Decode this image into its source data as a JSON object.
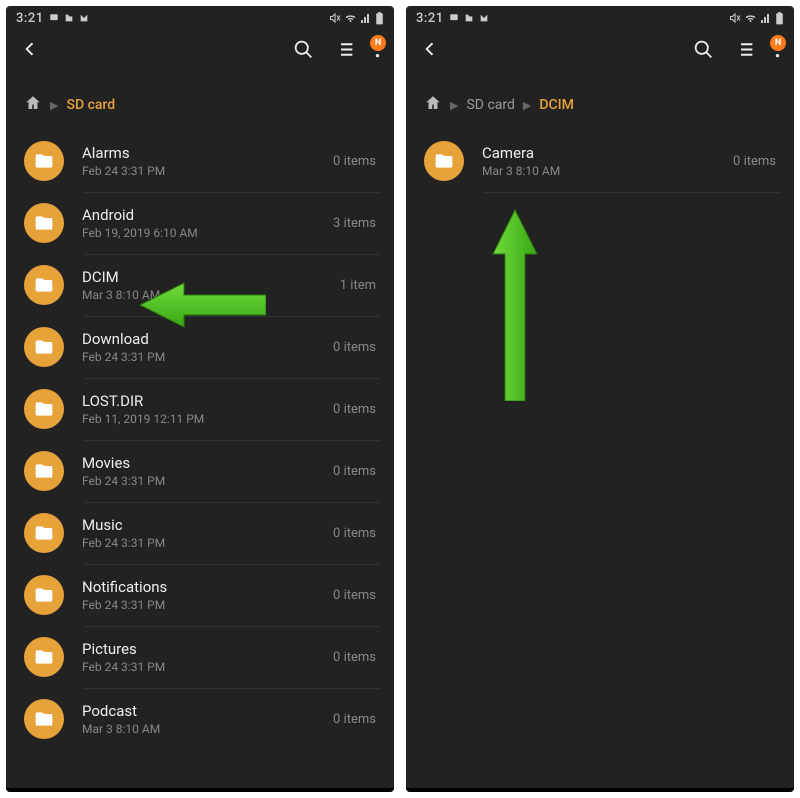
{
  "status": {
    "time": "3:21"
  },
  "notif_badge": "N",
  "screens": [
    {
      "breadcrumb": [
        {
          "label": "SD card",
          "last": true
        }
      ],
      "folders": [
        {
          "name": "Alarms",
          "date": "Feb 24 3:31 PM",
          "count": "0 items"
        },
        {
          "name": "Android",
          "date": "Feb 19, 2019 6:10 AM",
          "count": "3 items"
        },
        {
          "name": "DCIM",
          "date": "Mar 3 8:10 AM",
          "count": "1 item"
        },
        {
          "name": "Download",
          "date": "Feb 24 3:31 PM",
          "count": "0 items"
        },
        {
          "name": "LOST.DIR",
          "date": "Feb 11, 2019 12:11 PM",
          "count": "0 items"
        },
        {
          "name": "Movies",
          "date": "Feb 24 3:31 PM",
          "count": "0 items"
        },
        {
          "name": "Music",
          "date": "Feb 24 3:31 PM",
          "count": "0 items"
        },
        {
          "name": "Notifications",
          "date": "Feb 24 3:31 PM",
          "count": "0 items"
        },
        {
          "name": "Pictures",
          "date": "Feb 24 3:31 PM",
          "count": "0 items"
        },
        {
          "name": "Podcast",
          "date": "Mar 3 8:10 AM",
          "count": "0 items"
        }
      ]
    },
    {
      "breadcrumb": [
        {
          "label": "SD card",
          "last": false
        },
        {
          "label": "DCIM",
          "last": true
        }
      ],
      "folders": [
        {
          "name": "Camera",
          "date": "Mar 3 8:10 AM",
          "count": "0 items"
        }
      ]
    }
  ]
}
